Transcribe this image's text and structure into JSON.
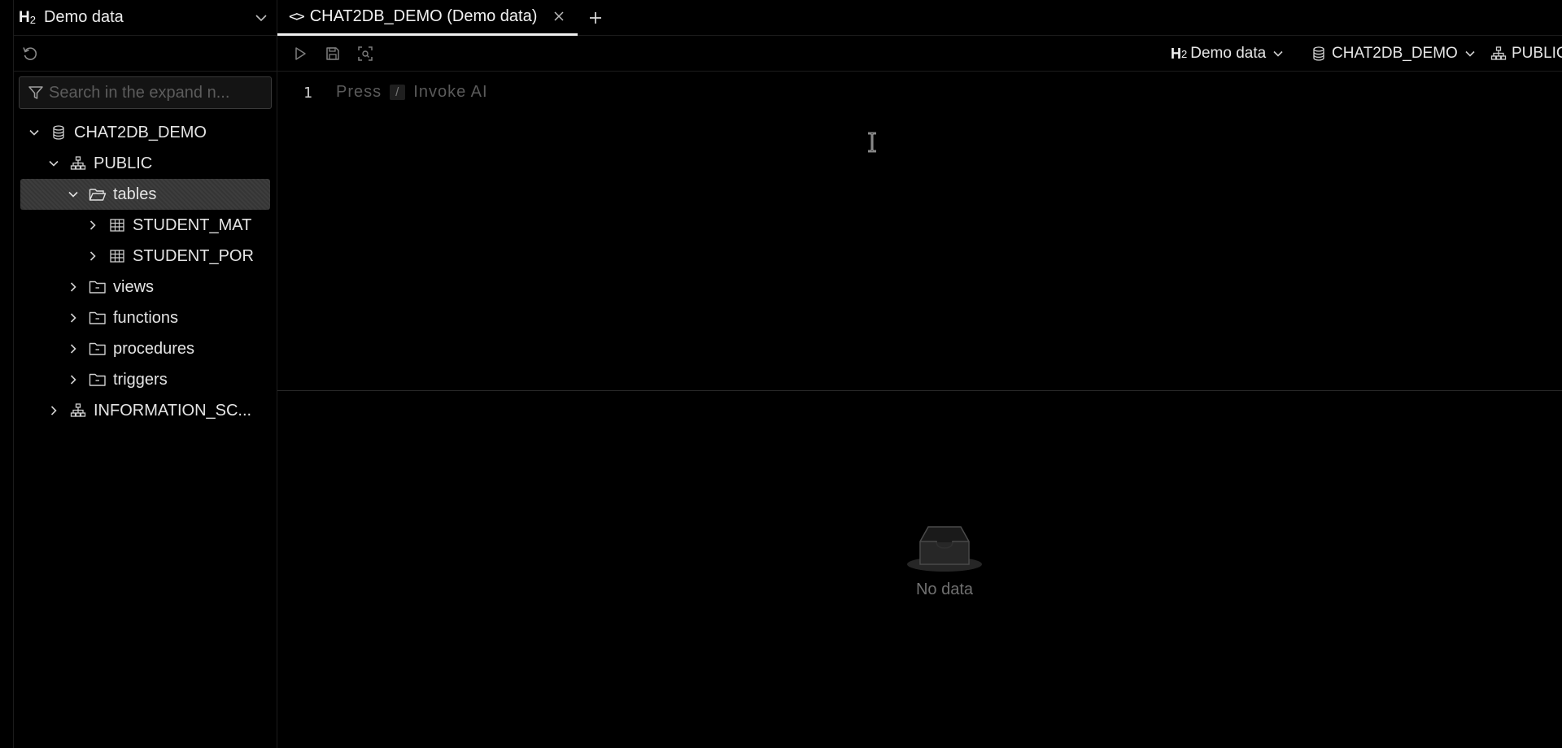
{
  "sidebar": {
    "db_select": {
      "logo": "H",
      "logo_sub": "2",
      "label": "Demo data"
    },
    "search": {
      "placeholder": "Search in the expand n..."
    },
    "tree": [
      {
        "label": "CHAT2DB_DEMO",
        "icon": "database-icon",
        "expanded": true,
        "level": 0
      },
      {
        "label": "PUBLIC",
        "icon": "schema-icon",
        "expanded": true,
        "level": 1
      },
      {
        "label": "tables",
        "icon": "folder-open-icon",
        "expanded": true,
        "level": 2,
        "selected": true
      },
      {
        "label": "STUDENT_MAT",
        "icon": "table-icon",
        "expanded": false,
        "level": 3
      },
      {
        "label": "STUDENT_POR",
        "icon": "table-icon",
        "expanded": false,
        "level": 3
      },
      {
        "label": "views",
        "icon": "folder-icon",
        "expanded": false,
        "level": 2
      },
      {
        "label": "functions",
        "icon": "folder-icon",
        "expanded": false,
        "level": 2
      },
      {
        "label": "procedures",
        "icon": "folder-icon",
        "expanded": false,
        "level": 2
      },
      {
        "label": "triggers",
        "icon": "folder-icon",
        "expanded": false,
        "level": 2
      },
      {
        "label": "INFORMATION_SC...",
        "icon": "schema-icon",
        "expanded": false,
        "level": 1
      }
    ]
  },
  "tabs": [
    {
      "label": "CHAT2DB_DEMO (Demo data)",
      "active": true
    }
  ],
  "toolbar": {
    "datasource": {
      "logo": "H",
      "logo_sub": "2",
      "label": "Demo data"
    },
    "database": {
      "label": "CHAT2DB_DEMO"
    },
    "schema": {
      "label": "PUBLIC"
    }
  },
  "editor": {
    "line_number": "1",
    "hint_before": "Press",
    "hint_key": "/",
    "hint_after": "Invoke AI"
  },
  "result": {
    "empty_text": "No data"
  }
}
